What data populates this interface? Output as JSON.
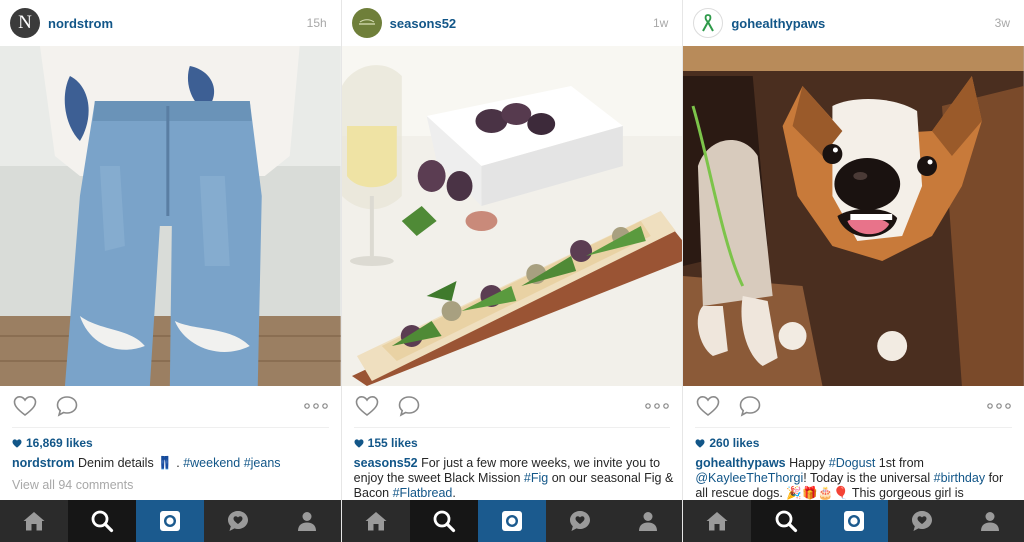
{
  "posts": [
    {
      "username": "nordstrom",
      "time": "15h",
      "avatar_letter": "N",
      "likes": "16,869 likes",
      "caption_user": "nordstrom",
      "caption_text": "Denim details",
      "caption_emoji": "👖",
      "caption_tags": [
        "#weekend",
        "#jeans"
      ],
      "comments_link": "View all 94 comments"
    },
    {
      "username": "seasons52",
      "time": "1w",
      "likes": "155 likes",
      "caption_user": "seasons52",
      "caption_text_1": "For just a few more weeks, we invite you to enjoy the sweet Black Mission",
      "caption_tag_1": "#Fig",
      "caption_text_2": "on our seasonal Fig & Bacon",
      "caption_tag_2": "#Flatbread",
      "caption_text_3": "."
    },
    {
      "username": "gohealthypaws",
      "time": "3w",
      "likes": "260 likes",
      "caption_user": "gohealthypaws",
      "caption_text_1": "Happy",
      "caption_tag_1": "#Dogust",
      "caption_text_2": "1st from",
      "caption_mention": "@KayleeTheThorgi",
      "caption_text_3": "! Today is the universal",
      "caption_tag_2": "#birthday",
      "caption_text_4": "for all rescue dogs.",
      "caption_emojis": "🎉🎁🎂🎈",
      "caption_text_5": "This gorgeous girl is"
    }
  ],
  "icons": {
    "like": "heart-outline-icon",
    "comment": "speech-bubble-icon",
    "more": "ellipsis-icon",
    "home": "home-icon",
    "search": "search-icon",
    "camera": "camera-icon",
    "activity": "heart-bubble-icon",
    "profile": "person-icon"
  },
  "colors": {
    "link": "#125688",
    "timestamp": "#a8a8a8",
    "tabbar": "#2b2b2b",
    "tab_active": "#1b5a8e"
  }
}
